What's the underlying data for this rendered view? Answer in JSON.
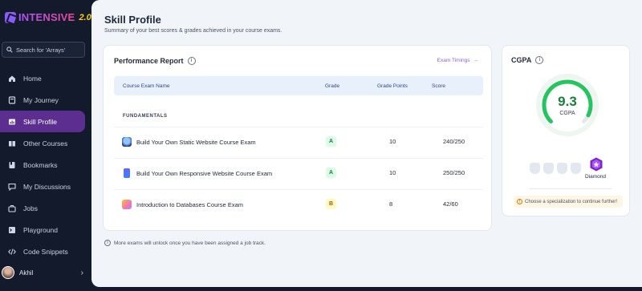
{
  "brand": {
    "name": "INTENSIVE",
    "version": "2.0"
  },
  "search": {
    "placeholder": "Search for 'Arrays'"
  },
  "nav": [
    {
      "label": "Home",
      "icon": "home-icon"
    },
    {
      "label": "My Journey",
      "icon": "journey-icon"
    },
    {
      "label": "Skill Profile",
      "icon": "skill-profile-icon",
      "active": true
    },
    {
      "label": "Other Courses",
      "icon": "book-icon"
    },
    {
      "label": "Bookmarks",
      "icon": "bookmark-icon"
    },
    {
      "label": "My Discussions",
      "icon": "chat-icon"
    },
    {
      "label": "Jobs",
      "icon": "briefcase-icon"
    },
    {
      "label": "Playground",
      "icon": "terminal-icon"
    },
    {
      "label": "Code Snippets",
      "icon": "code-icon"
    }
  ],
  "user": {
    "name": "Akhil"
  },
  "page": {
    "title": "Skill Profile",
    "subtitle": "Summary of your best scores & grades achieved in your course exams."
  },
  "performance": {
    "title": "Performance Report",
    "exam_link": "Exam Timings",
    "columns": {
      "name": "Course Exam Name",
      "grade": "Grade",
      "points": "Grade Points",
      "score": "Score"
    },
    "section": "FUNDAMENTALS",
    "rows": [
      {
        "name": "Build Your Own Static Website Course Exam",
        "grade": "A",
        "points": "10",
        "score": "240/250"
      },
      {
        "name": "Build Your Own Responsive Website Course Exam",
        "grade": "A",
        "points": "10",
        "score": "250/250"
      },
      {
        "name": "Introduction to Databases Course Exam",
        "grade": "B",
        "points": "8",
        "score": "42/60"
      }
    ]
  },
  "note": "More exams will unlock once you have been assigned a job track.",
  "cgpa": {
    "title": "CGPA",
    "value": "9.3",
    "label": "CGPA",
    "progress": 0.93,
    "tier": "Diamond",
    "hint": "Choose a specialization to continue further!"
  },
  "colors": {
    "accent": "#8b5cf6",
    "sidebar": "#131a2b",
    "active": "#5b2e8f",
    "gauge": "#22c55e"
  }
}
